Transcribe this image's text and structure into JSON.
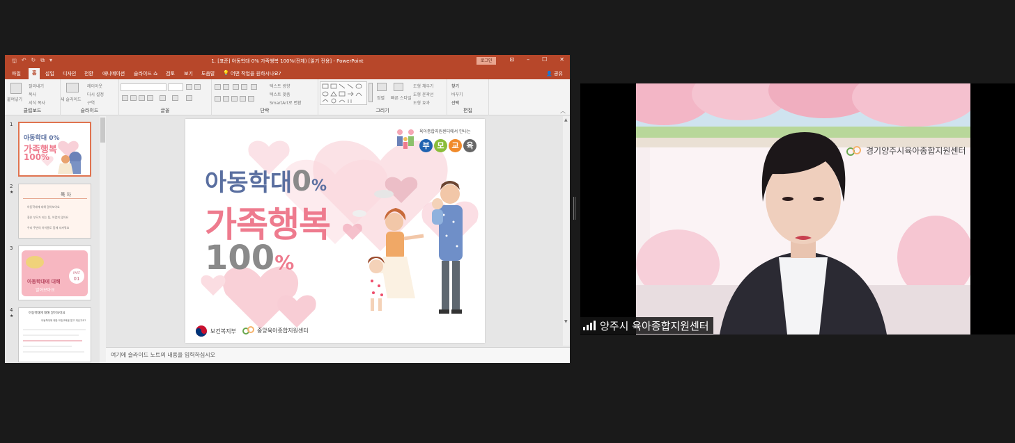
{
  "window": {
    "title": "1. [표준] 아동학대 0% 가족행복 100%(전체) [읽기 전용] - PowerPoint",
    "login_label": "로그인",
    "win_controls": [
      "⊡",
      "–",
      "☐",
      "✕"
    ]
  },
  "menu": {
    "tabs": [
      "파일",
      "홈",
      "삽입",
      "디자인",
      "전환",
      "애니메이션",
      "슬라이드 쇼",
      "검토",
      "보기",
      "도움말"
    ],
    "active_tab_short": "홈",
    "tell_me": "어떤 작업을 원하시나요?",
    "share": "공유"
  },
  "ribbon": {
    "clipboard": {
      "paste": "붙여넣기",
      "cut": "잘라내기",
      "copy": "복사",
      "format_painter": "서식 복사",
      "label": "클립보드"
    },
    "slides": {
      "new_slide": "새 슬라이드",
      "layout": "레이아웃",
      "reset": "다시 설정",
      "section": "구역",
      "label": "슬라이드"
    },
    "font": {
      "label": "글꼴"
    },
    "paragraph": {
      "text_direction": "텍스트 방향",
      "align_text": "텍스트 맞춤",
      "smartart": "SmartArt로 변환",
      "label": "단락"
    },
    "drawing": {
      "arrange": "정렬",
      "quick_styles": "빠른 스타일",
      "fill": "도형 채우기",
      "outline": "도형 윤곽선",
      "effects": "도형 효과",
      "label": "그리기"
    },
    "editing": {
      "find": "찾기",
      "replace": "바꾸기",
      "select": "선택",
      "label": "편집"
    }
  },
  "thumbnails": [
    {
      "num": "1",
      "title1": "아동학대 0%",
      "title2": "가족행복",
      "title3": "100%"
    },
    {
      "num": "2",
      "heading": "목 차",
      "items": [
        "아동학대에 대해 알아보아요",
        "좋은 부모가 되는 팁, 어렵지 않아요",
        "우리 주변의 아이들도 함께 지켜줘요"
      ]
    },
    {
      "num": "3",
      "part": "PART",
      "part_num": "01",
      "line1": "아동학대에 대해",
      "line2": "알아보아요"
    },
    {
      "num": "4",
      "heading": "아동학대에 대해 알아보아요",
      "sub": "아동학대에 대한 보호교육을 알고 계신가요?"
    }
  ],
  "slide": {
    "banner_small": "육아종합지원센터에서 만나는",
    "banner_chars": [
      "부",
      "모",
      "교",
      "육"
    ],
    "title_line1": "아동학대",
    "title_line1_num": "0",
    "title_line1_unit": "%",
    "title_line2": "가족행복",
    "title_line3": "100",
    "title_line3_unit": "%",
    "logo1": "보건복지부",
    "logo2": "중앙육아종합지원센터"
  },
  "notes_placeholder": "여기에 슬라이드 노트의 내용을 입력하십시오",
  "video": {
    "participant_name": "양주시 육아종합지원센터",
    "backdrop_sign": "경기양주시육아종합지원센터"
  },
  "colors": {
    "ppt_accent": "#b7472a",
    "title_blue": "#5a6fa0",
    "title_pink": "#ee7b8e",
    "title_gray": "#8a8a8a"
  }
}
